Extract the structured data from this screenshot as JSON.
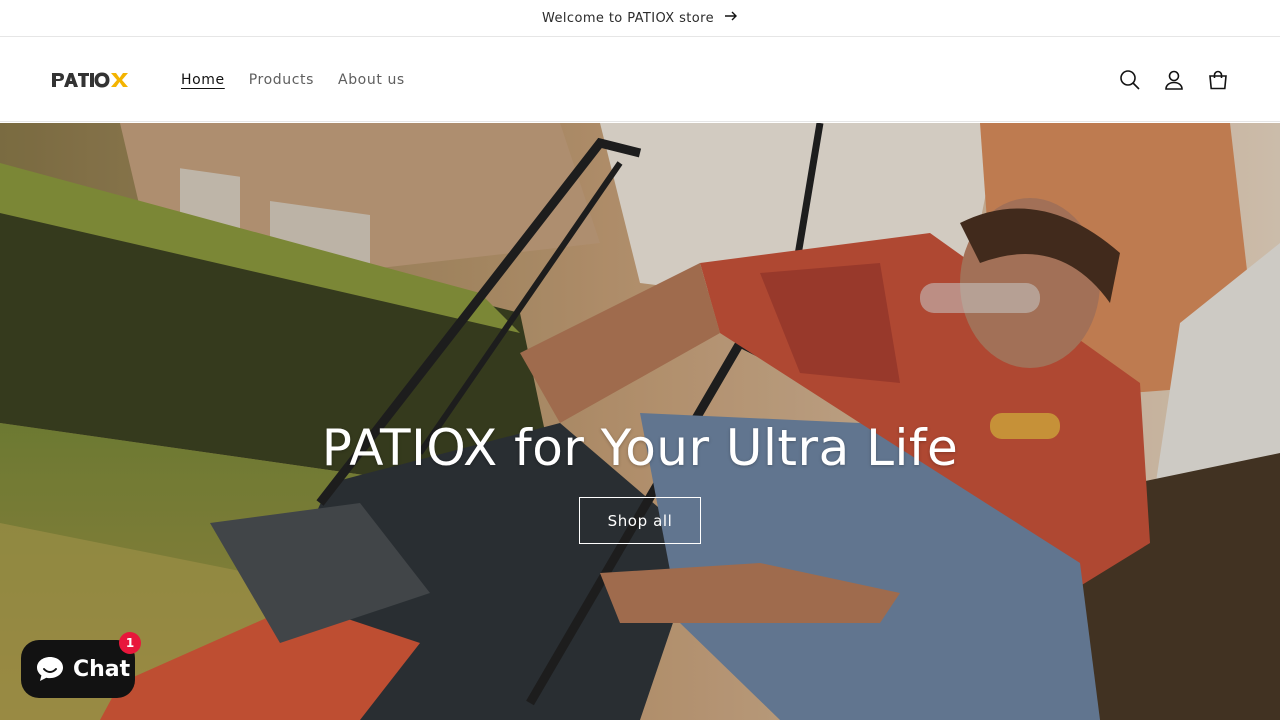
{
  "announcement": {
    "text": "Welcome to PATIOX store"
  },
  "logo": {
    "alt": "PATIOX"
  },
  "nav": {
    "items": [
      {
        "label": "Home",
        "active": true
      },
      {
        "label": "Products",
        "active": false
      },
      {
        "label": "About us",
        "active": false
      }
    ]
  },
  "header_icons": [
    "search-icon",
    "account-icon",
    "cart-icon"
  ],
  "hero": {
    "title": "PATIOX for Your Ultra Life",
    "button_label": "Shop all"
  },
  "chat": {
    "label": "Chat",
    "badge": "1"
  },
  "colors": {
    "accent_logo": "#f4b400",
    "chat_bg": "#121212",
    "badge": "#e8173b"
  }
}
